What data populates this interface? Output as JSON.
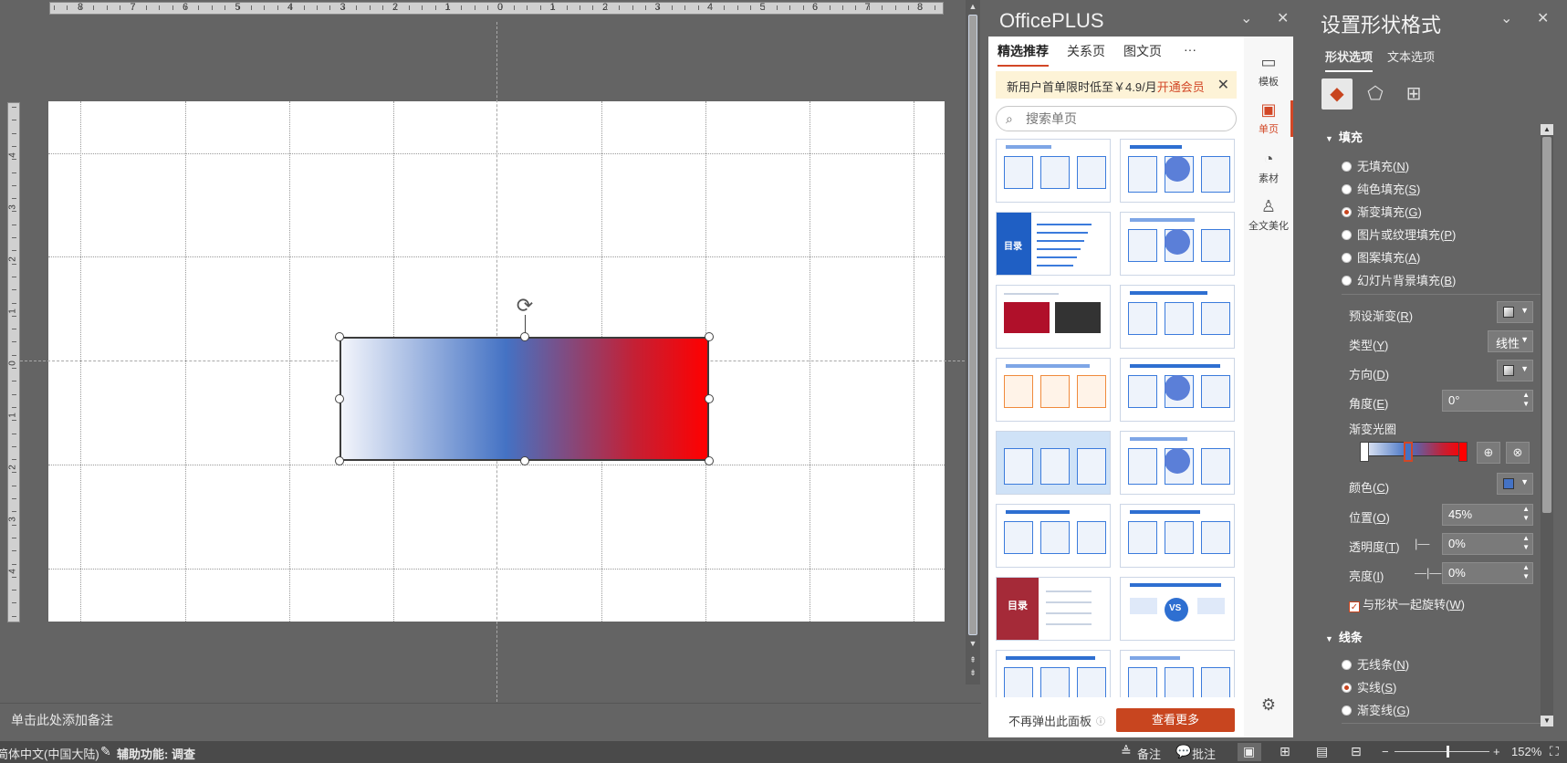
{
  "editor": {
    "hruler_labels": [
      "8",
      "7",
      "6",
      "5",
      "4",
      "3",
      "2",
      "1",
      "0",
      "1",
      "2",
      "3",
      "4",
      "5",
      "6",
      "7",
      "8"
    ],
    "vruler_labels": [
      "4",
      "3",
      "2",
      "1",
      "0",
      "1",
      "2",
      "3",
      "4"
    ],
    "notes_placeholder": "单击此处添加备注"
  },
  "officeplus": {
    "title": "OfficePLUS",
    "tabs": [
      "精选推荐",
      "关系页",
      "图文页",
      "···"
    ],
    "active_tab": 0,
    "promo_text": "新用户首单限时低至￥4.9/月",
    "promo_link": "开通会员",
    "search_placeholder": "搜索单页",
    "thumb_label_1": "目录",
    "thumb_label_2": "目录",
    "thumb_label_3": "VS",
    "footer_nomore": "不再弹出此面板",
    "footer_more": "查看更多",
    "side": [
      {
        "label": "模板",
        "icon": "template-icon"
      },
      {
        "label": "单页",
        "icon": "single-page-icon"
      },
      {
        "label": "素材",
        "icon": "material-icon"
      },
      {
        "label": "全文美化",
        "icon": "beautify-icon"
      }
    ]
  },
  "format_pane": {
    "title": "设置形状格式",
    "tabs": [
      "形状选项",
      "文本选项"
    ],
    "fill_section": "填充",
    "fill_options": [
      {
        "label": "无填充(",
        "key": "N",
        "selected": false
      },
      {
        "label": "纯色填充(",
        "key": "S",
        "selected": false
      },
      {
        "label": "渐变填充(",
        "key": "G",
        "selected": true
      },
      {
        "label": "图片或纹理填充(",
        "key": "P",
        "selected": false
      },
      {
        "label": "图案填充(",
        "key": "A",
        "selected": false
      },
      {
        "label": "幻灯片背景填充(",
        "key": "B",
        "selected": false
      }
    ],
    "preset_label": "预设渐变(",
    "preset_key": "R",
    "type_label": "类型(",
    "type_key": "Y",
    "type_value": "线性",
    "direction_label": "方向(",
    "direction_key": "D",
    "angle_label": "角度(",
    "angle_key": "E",
    "angle_value": "0°",
    "stops_label": "渐变光圈",
    "color_label": "颜色(",
    "color_key": "C",
    "position_label": "位置(",
    "position_key": "O",
    "position_value": "45%",
    "transparency_label": "透明度(",
    "transparency_key": "T",
    "transparency_value": "0%",
    "brightness_label": "亮度(",
    "brightness_key": "I",
    "brightness_value": "0%",
    "rotate_label": "与形状一起旋转(",
    "rotate_key": "W",
    "line_section": "线条",
    "line_options": [
      {
        "label": "无线条(",
        "key": "N",
        "selected": false
      },
      {
        "label": "实线(",
        "key": "S",
        "selected": true
      },
      {
        "label": "渐变线(",
        "key": "G",
        "selected": false
      }
    ]
  },
  "status": {
    "language": "简体中文(中国大陆)",
    "accessibility": "辅助功能: 调查",
    "notes": "备注",
    "comments": "批注",
    "zoom": "152%"
  },
  "colors": {
    "gradient_start": "#f3f5fb",
    "gradient_mid": "#4472c4",
    "gradient_end": "#ff0000",
    "accent": "#c8451f"
  }
}
